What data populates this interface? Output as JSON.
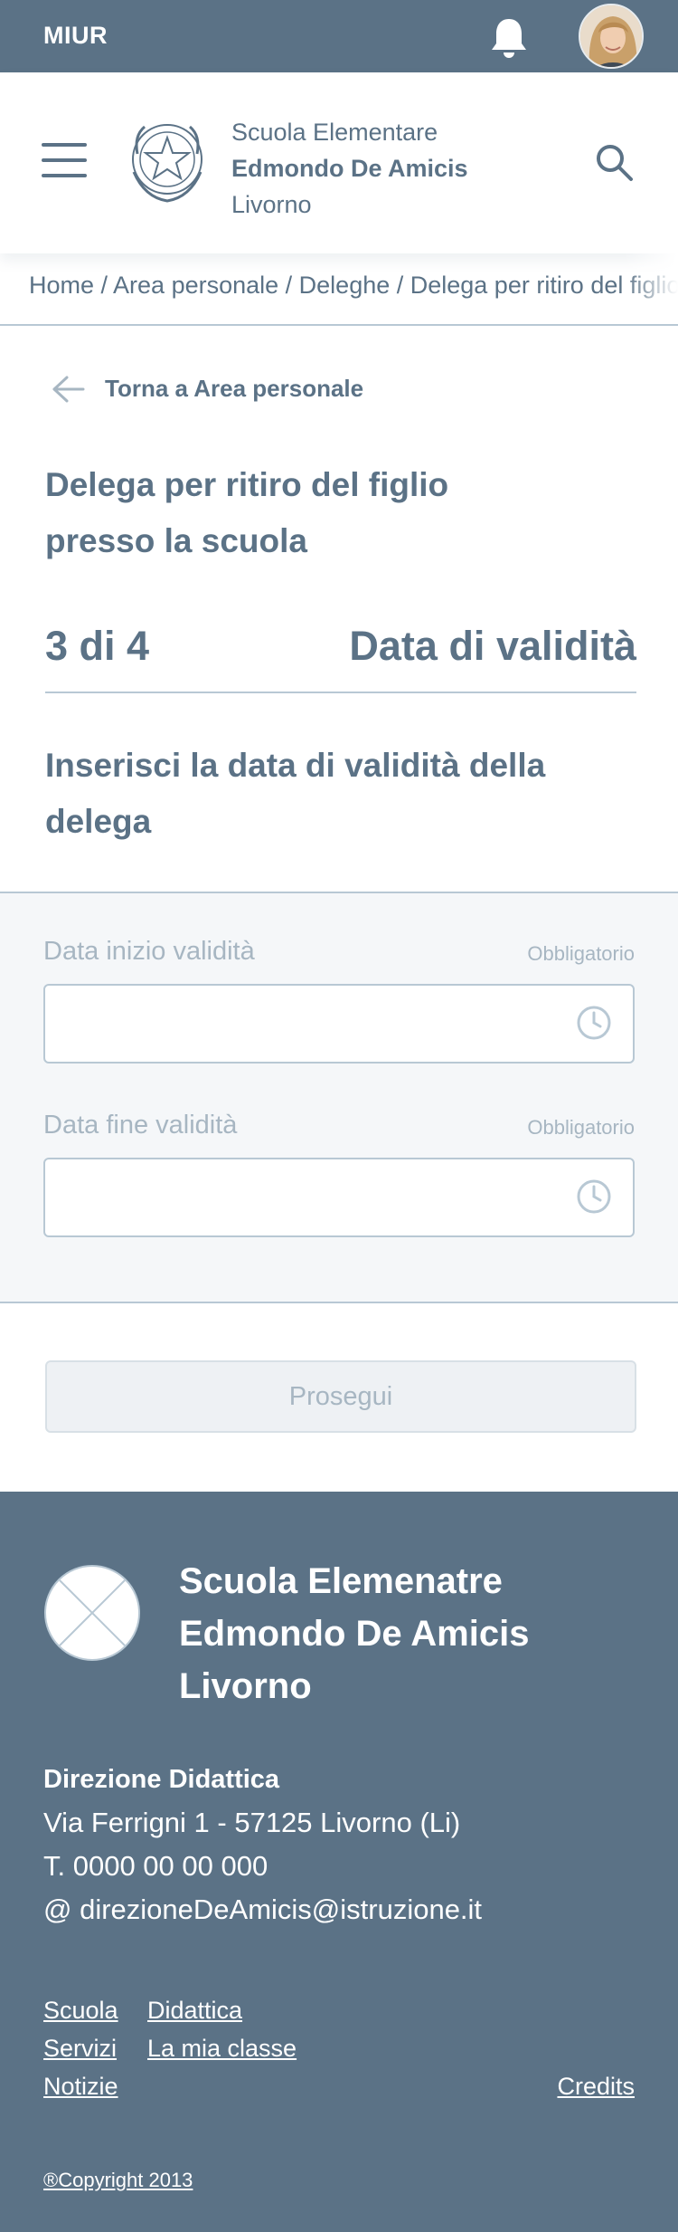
{
  "topbar": {
    "brand": "MIUR",
    "bell_icon": "bell-icon",
    "avatar_icon": "user-avatar"
  },
  "header": {
    "menu_icon": "hamburger-menu-icon",
    "emblem_icon": "italian-republic-emblem",
    "school_line1": "Scuola Elementare",
    "school_line2": "Edmondo De Amicis",
    "school_line3": "Livorno",
    "search_icon": "search-icon"
  },
  "breadcrumb": {
    "text": "Home / Area personale / Deleghe / Delega per ritiro del figlio presso la scuola"
  },
  "back": {
    "icon": "arrow-left-icon",
    "label": "Torna a Area personale"
  },
  "page": {
    "title": "Delega per ritiro del figlio presso la scuola"
  },
  "stepper": {
    "count": "3 di 4",
    "step_name": "Data di validità"
  },
  "section": {
    "title": "Inserisci la data di validità della delega"
  },
  "form": {
    "field1_label": "Data inizio validità",
    "field1_required": "Obbligatorio",
    "field1_value": "",
    "field2_label": "Data fine validità",
    "field2_required": "Obbligatorio",
    "field2_value": "",
    "clock_icon": "clock-icon"
  },
  "actions": {
    "continue_label": "Prosegui"
  },
  "footer": {
    "logo_icon": "placeholder-logo",
    "school_line1": "Scuola Elemenatre",
    "school_line2": "Edmondo De Amicis",
    "school_line3": "Livorno",
    "directorate": "Direzione Didattica",
    "address": "Via Ferrigni 1 - 57125 Livorno (Li)",
    "phone": "T. 0000 00 00 000",
    "email": "@ direzioneDeAmicis@istruzione.it",
    "links": {
      "scuola": "Scuola",
      "didattica": "Didattica",
      "servizi": "Servizi",
      "la_mia_classe": "La mia classe",
      "notizie": "Notizie",
      "credits": "Credits"
    },
    "copyright": "®Copyright 2013"
  },
  "colors": {
    "primary": "#5b7286",
    "muted": "#a7b6c2",
    "border": "#b8c8d4",
    "form_bg": "#f5f7f9"
  }
}
